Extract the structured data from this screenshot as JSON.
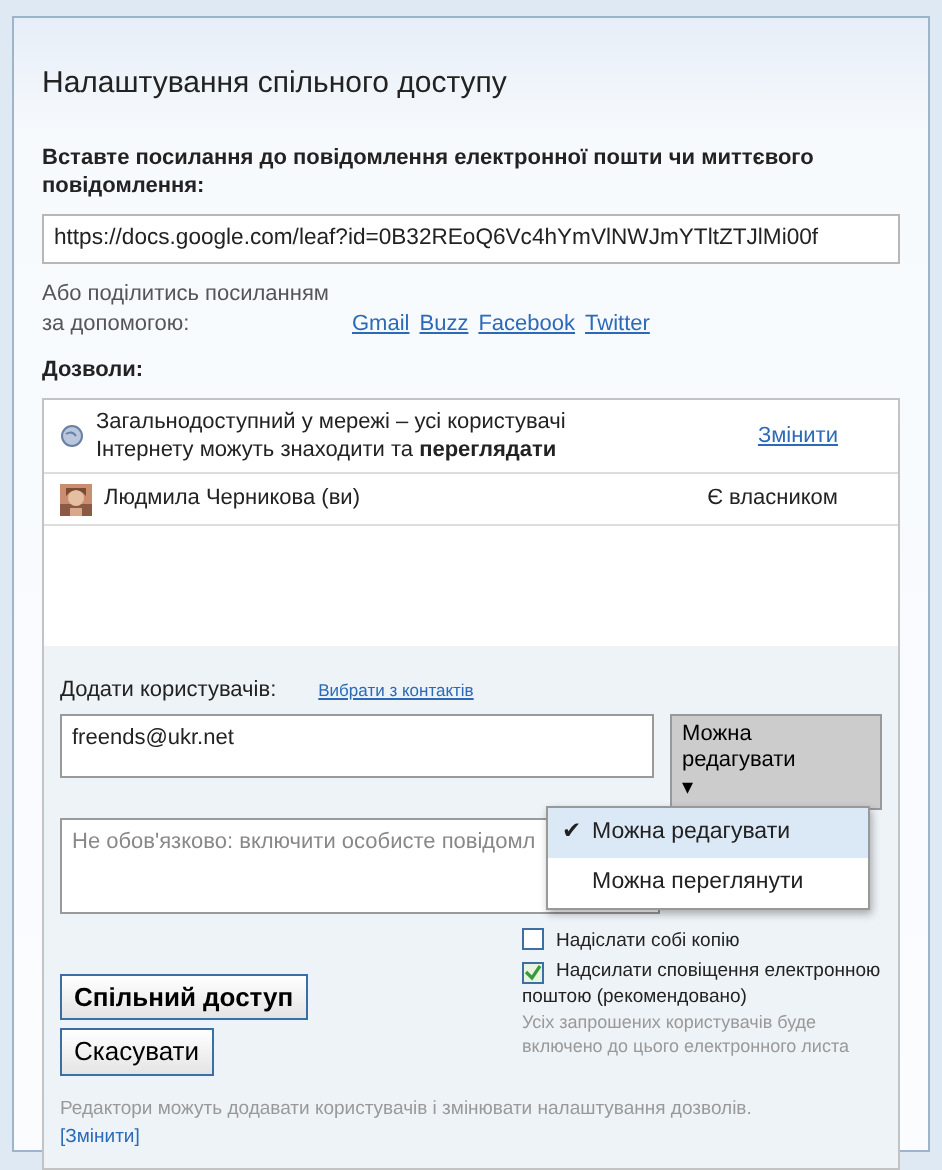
{
  "dialog": {
    "title": "Налаштування спільного доступу"
  },
  "link_section": {
    "label": "Вставте посилання до повідомлення електронної пошти чи миттєвого повідомлення:",
    "url": "https://docs.google.com/leaf?id=0B32REoQ6Vc4hYmVlNWJmYTltZTJlMi00f"
  },
  "share_via": {
    "text": "Або поділитись посиланням за допомогою:",
    "links": [
      "Gmail",
      "Buzz",
      "Facebook",
      "Twitter"
    ]
  },
  "permissions": {
    "label": "Дозволи:",
    "rows": [
      {
        "kind": "visibility",
        "text": "Загальнодоступний у мережі – усі користувачі Інтернету можуть знаходити та **переглядати**",
        "action": "Змінити"
      },
      {
        "kind": "person",
        "text": "Людмила Черникова (ви)",
        "role": "Є власником"
      }
    ]
  },
  "add_people": {
    "label": "Додати користувачів:",
    "contacts_link": "Вибрати з контактів",
    "value": "freends@ukr.net",
    "message": "Не обов'язково: включити особисте повідомл",
    "role_button": "Можна редагувати",
    "caret": "▾",
    "check_mark": "✔",
    "role_menu": [
      {
        "label": "Можна редагувати",
        "selected": true
      },
      {
        "label": "Можна переглянути",
        "selected": false
      }
    ]
  },
  "options": [
    {
      "label": "Надіслати собі копію",
      "checked": false
    },
    {
      "label": "Надсилати сповіщення електронною поштою (рекомендовано)",
      "checked": true
    }
  ],
  "options_hint": "Усіх запрошених користувачів буде включено до цього електронного листа",
  "buttons": [
    "Спільний доступ",
    "Скасувати"
  ],
  "footer": {
    "text": "Редактори можуть додавати користувачів і змінювати налаштування дозволів.",
    "link": "[Змінити]"
  }
}
